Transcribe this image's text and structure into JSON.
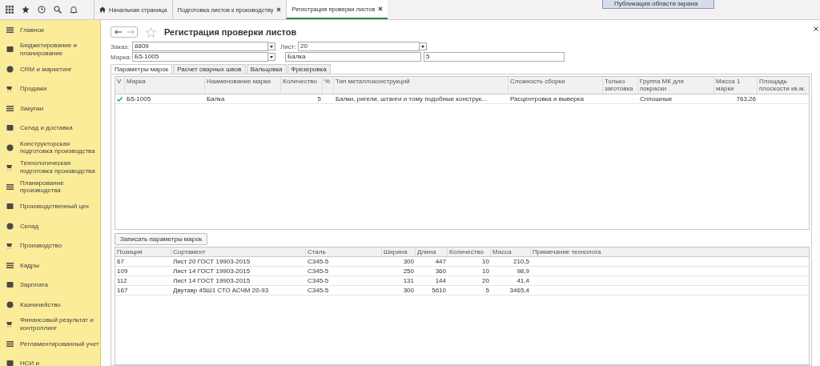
{
  "tooltip": "Публикация области экрана",
  "top_tabs": [
    {
      "label": "Начальная страница",
      "kind": "home",
      "selected": false
    },
    {
      "label": "Подготовка листов к производству",
      "kind": "closable",
      "selected": false
    },
    {
      "label": "Регистрация проверки листов",
      "kind": "closable",
      "selected": true
    }
  ],
  "sidebar": {
    "items": [
      {
        "label": "Главное"
      },
      {
        "label": "Бюджетирование и планирование"
      },
      {
        "label": "CRM и маркетинг"
      },
      {
        "label": "Продажи"
      },
      {
        "label": "Закупки"
      },
      {
        "label": "Склад и доставка"
      },
      {
        "label": "Конструкторская подготовка производства"
      },
      {
        "label": "Технологическая подготовка производства"
      },
      {
        "label": "Планирование производства"
      },
      {
        "label": "Производственный цех"
      },
      {
        "label": "Склад"
      },
      {
        "label": "Производство"
      },
      {
        "label": "Кадры"
      },
      {
        "label": "Зарплата"
      },
      {
        "label": "Казначейство"
      },
      {
        "label": "Финансовый результат и контроллинг"
      },
      {
        "label": "Регламентированный учет"
      },
      {
        "label": "НСИ и"
      }
    ]
  },
  "form": {
    "title": "Регистрация проверки листов",
    "order": {
      "label": "Заказ:",
      "value": "8809"
    },
    "sheet": {
      "label": "Лист:",
      "value": "20"
    },
    "mark": {
      "label": "Марка:",
      "value": "Б5-1005"
    },
    "mark_name": {
      "value": "Балка"
    },
    "quantity": {
      "value": "5"
    }
  },
  "tabs": [
    {
      "label": "Параметры марок",
      "selected": true
    },
    {
      "label": "Расчет сварных швов",
      "selected": false
    },
    {
      "label": "Вальцовка",
      "selected": false
    },
    {
      "label": "Фрезеровка",
      "selected": false
    }
  ],
  "marks_table": {
    "columns": [
      "V",
      "Марка",
      "Наименование марки",
      "Количество",
      "%",
      "Тип металлоконструкций",
      "Сложность сборки",
      "Только заготовка",
      "Группа МК для покраски",
      "Масса 1 марки",
      "Площадь плоскости кв.м."
    ],
    "rows": [
      {
        "checked": true,
        "cells": [
          "",
          "Б5-1005",
          "Балка",
          "5",
          "",
          "Балки, ригели, штанги и тому подобные конструк...",
          "Расцентровка и выверка",
          "",
          "Сплошные",
          "763,26",
          ""
        ]
      }
    ]
  },
  "save_button": "Записать параметры марок",
  "sheets_table": {
    "columns": [
      "Позиция",
      "Сортамент",
      "Сталь",
      "Ширина",
      "Длина",
      "Количество",
      "Масса",
      "Примечание технолога"
    ],
    "rows": [
      [
        "67",
        "Лист 20 ГОСТ 19903-2015",
        "С345-5",
        "300",
        "447",
        "10",
        "210,5",
        ""
      ],
      [
        "109",
        "Лист 14 ГОСТ 19903-2015",
        "С345-5",
        "250",
        "360",
        "10",
        "98,9",
        ""
      ],
      [
        "112",
        "Лист 14 ГОСТ 19903-2015",
        "С345-5",
        "131",
        "144",
        "20",
        "41,4",
        ""
      ],
      [
        "167",
        "Двутавр 45Ш1 СТО АСЧМ 20-93",
        "С345-5",
        "300",
        "5610",
        "5",
        "3465,4",
        ""
      ]
    ]
  }
}
